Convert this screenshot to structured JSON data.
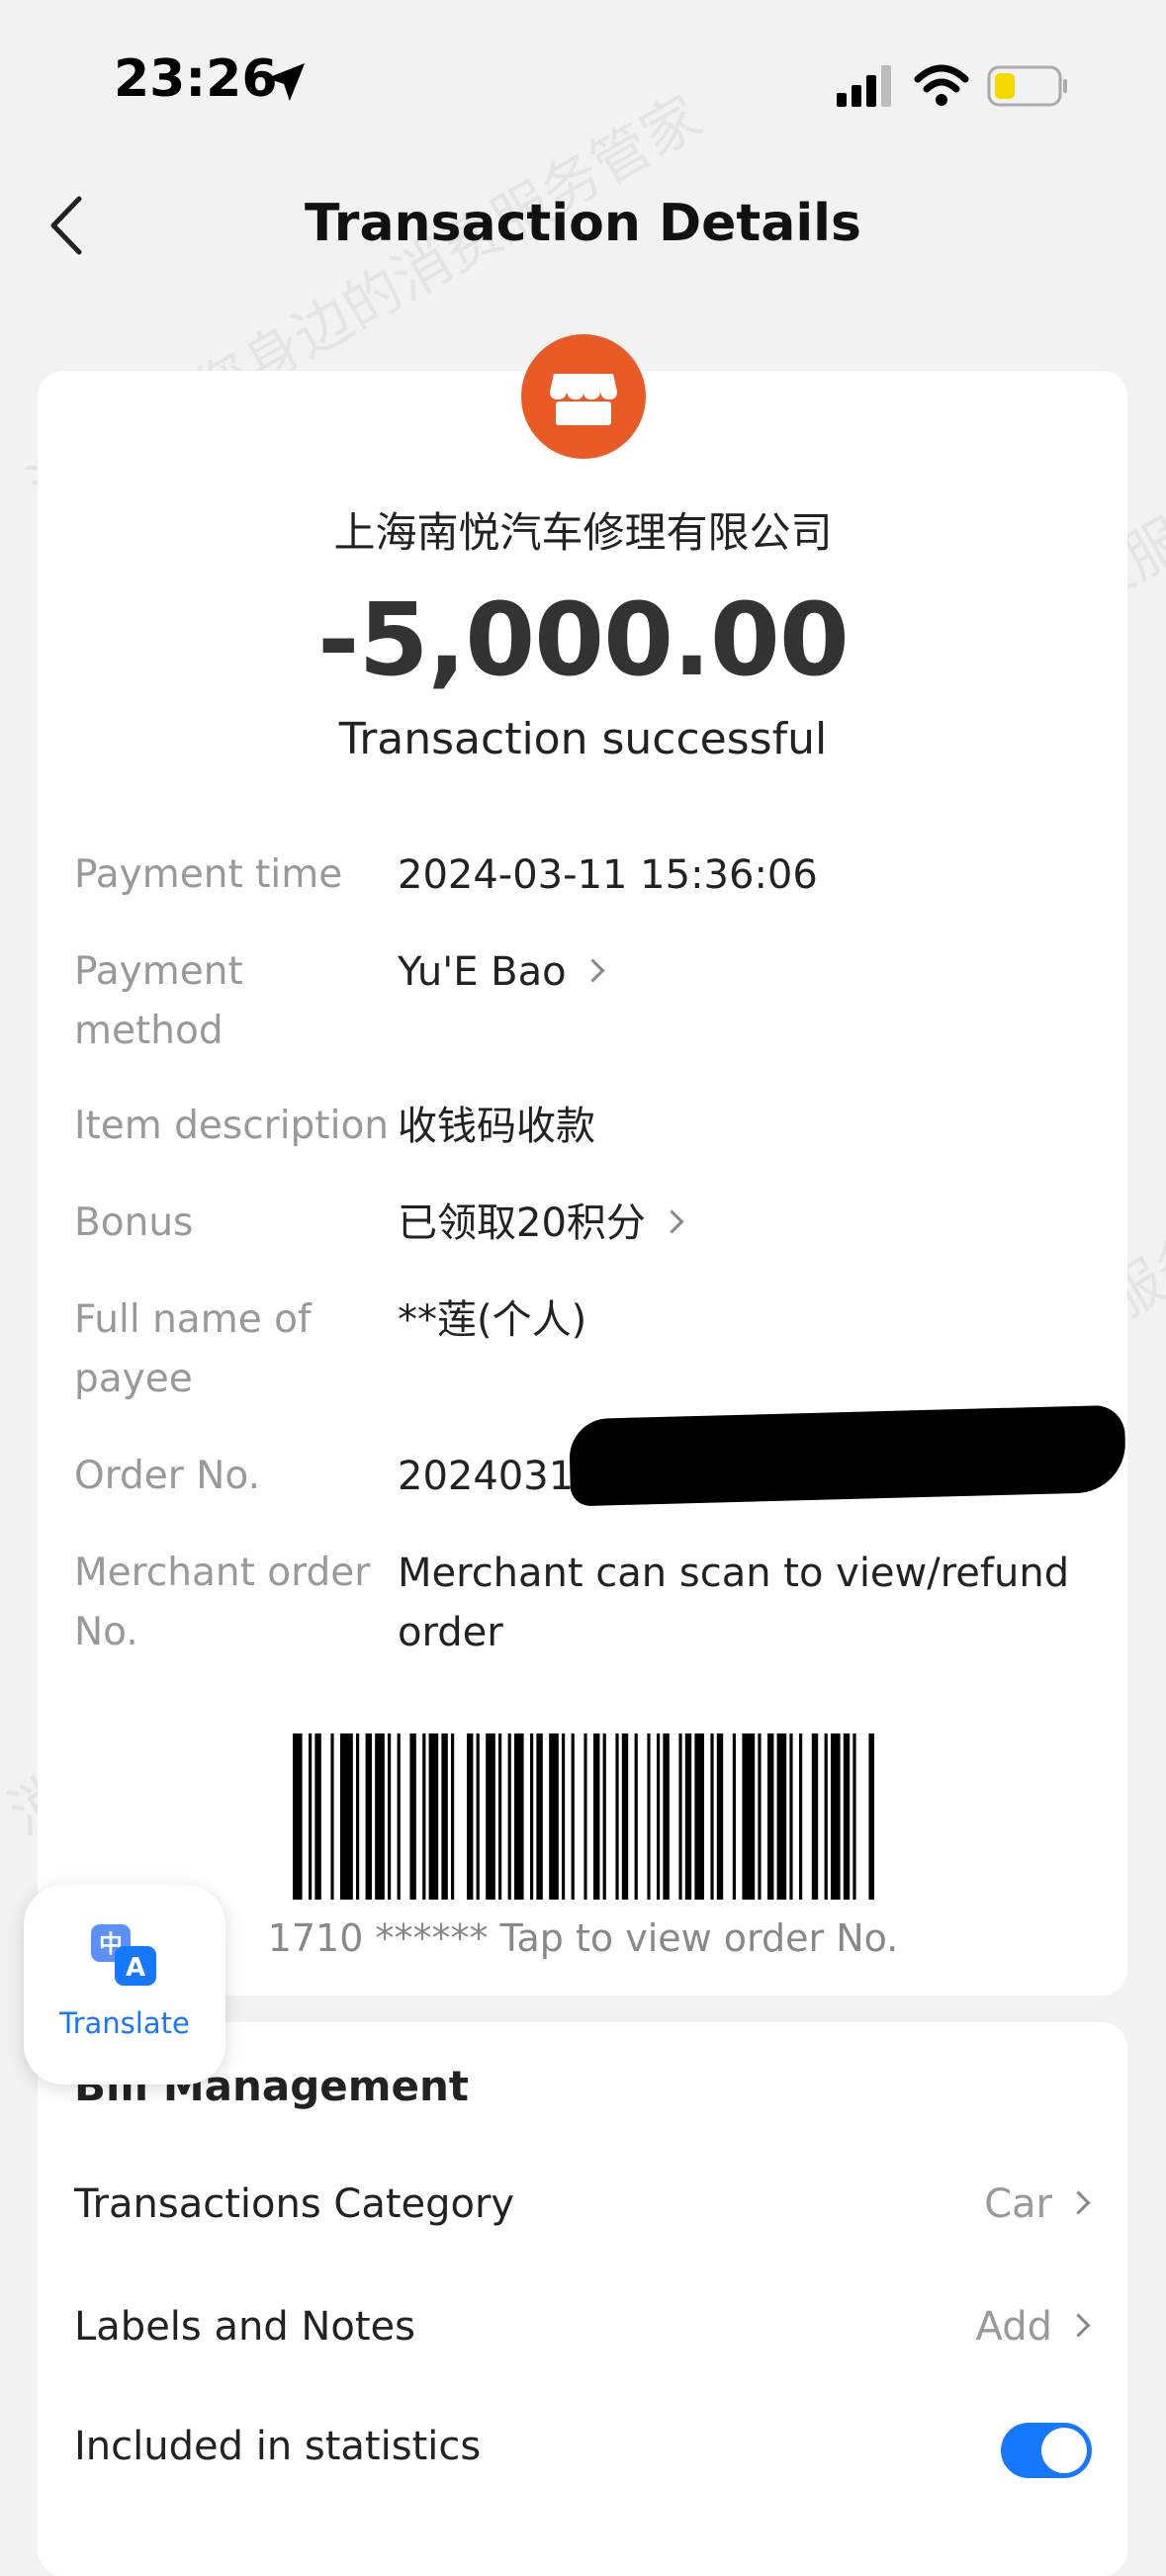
{
  "status_bar": {
    "time": "23:26"
  },
  "nav": {
    "title": "Transaction Details"
  },
  "transaction": {
    "merchant": "上海南悦汽车修理有限公司",
    "amount": "-5,000.00",
    "status": "Transaction successful"
  },
  "details": [
    {
      "label": "Payment time",
      "value": "2024-03-11 15:36:06"
    },
    {
      "label": "Payment method",
      "value": "Yu'E Bao"
    },
    {
      "label": "Item description",
      "value": "收钱码收款"
    },
    {
      "label": "Bonus",
      "value": "已领取20积分"
    },
    {
      "label": "Full name of payee",
      "value": "**莲(个人)"
    },
    {
      "label": "Order No.",
      "value": "20240311"
    },
    {
      "label": "Merchant order No.",
      "value": "Merchant can scan to view/refund order"
    }
  ],
  "barcode": {
    "caption": "1710 ****** Tap to view order No."
  },
  "translate": {
    "label": "Translate",
    "icon": "translate-icon"
  },
  "bill_management": {
    "title": "Bill Management",
    "category_label": "Transactions Category",
    "category_value": "Car",
    "labels_label": "Labels and Notes",
    "labels_value": "Add",
    "stats_label": "Included in statistics",
    "stats_enabled": true
  },
  "colors": {
    "accent": "#1677ff",
    "merchant_icon": "#ea5a24"
  },
  "watermark": {
    "text": "消费保 您身边的消费服务管家"
  }
}
